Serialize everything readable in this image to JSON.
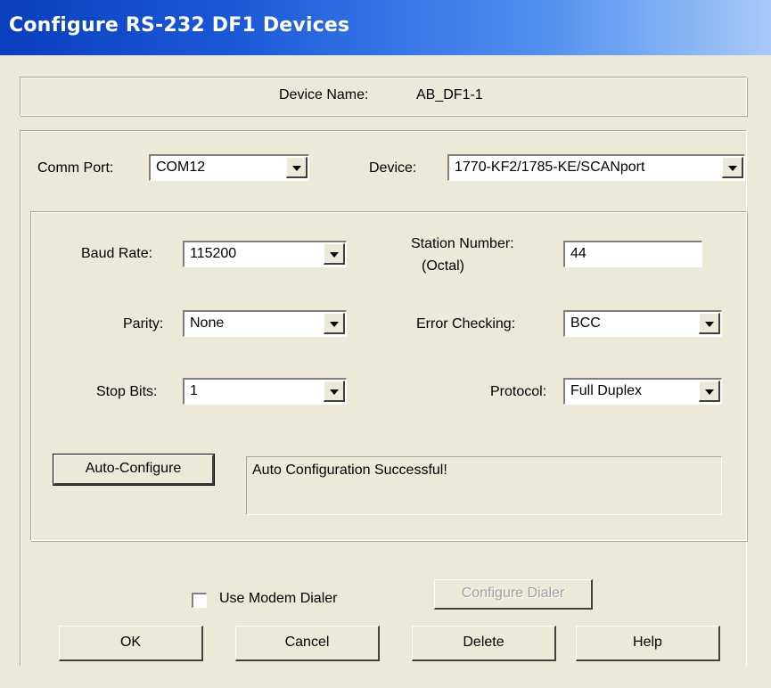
{
  "window": {
    "title": "Configure RS-232 DF1 Devices"
  },
  "device_name": {
    "label": "Device Name:",
    "value": "AB_DF1-1"
  },
  "comm_port": {
    "label": "Comm Port:",
    "value": "COM12"
  },
  "device": {
    "label": "Device:",
    "value": "1770-KF2/1785-KE/SCANport"
  },
  "baud_rate": {
    "label": "Baud Rate:",
    "value": "115200"
  },
  "station_number": {
    "label_line1": "Station Number:",
    "label_line2": "(Octal)",
    "value": "44"
  },
  "parity": {
    "label": "Parity:",
    "value": "None"
  },
  "error_checking": {
    "label": "Error Checking:",
    "value": "BCC"
  },
  "stop_bits": {
    "label": "Stop Bits:",
    "value": "1"
  },
  "protocol": {
    "label": "Protocol:",
    "value": "Full Duplex"
  },
  "auto_configure": {
    "button_label": "Auto-Configure",
    "status": "Auto Configuration Successful!"
  },
  "modem": {
    "checkbox_label": "Use Modem Dialer",
    "checked": false,
    "configure_label": "Configure Dialer"
  },
  "footer": {
    "ok": "OK",
    "cancel": "Cancel",
    "delete": "Delete",
    "help": "Help"
  }
}
